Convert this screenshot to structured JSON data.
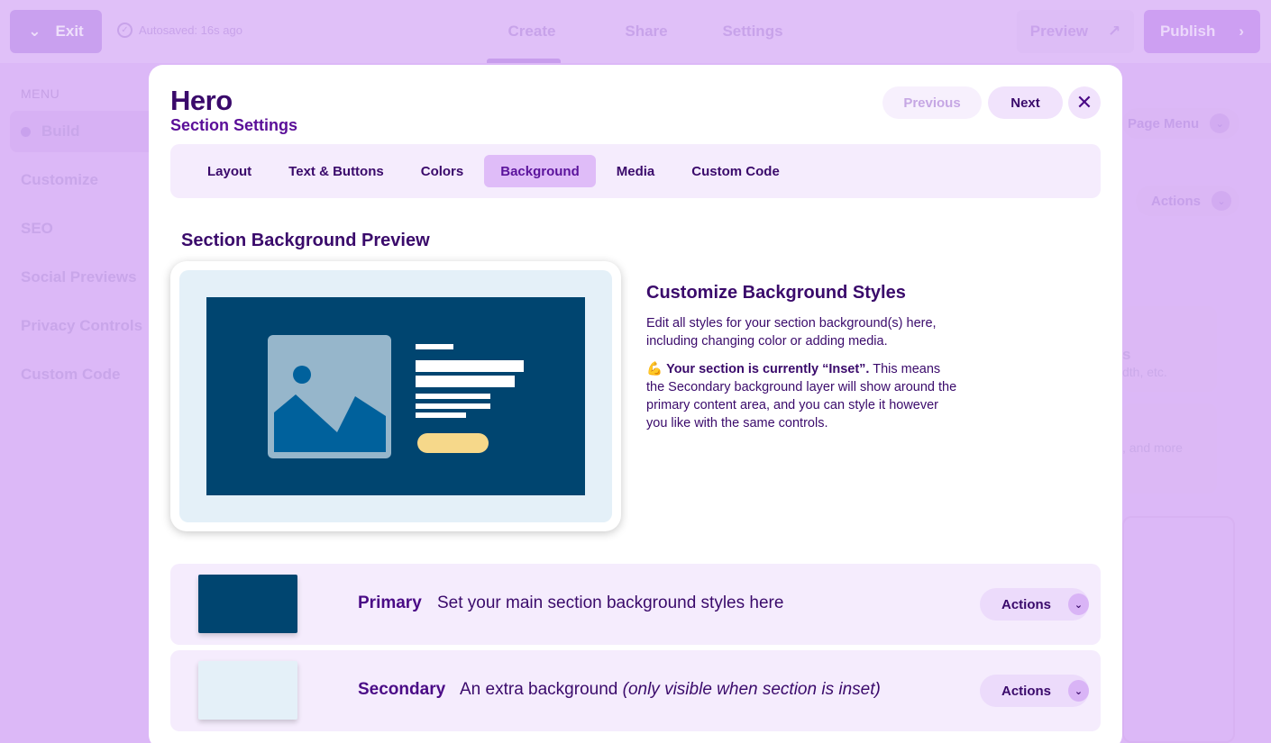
{
  "topbar": {
    "exit_label": "Exit",
    "autosave_text": "Autosaved: 16s ago",
    "tabs": [
      "Create",
      "Share",
      "Settings"
    ],
    "preview_label": "Preview",
    "publish_label": "Publish"
  },
  "sidebar": {
    "heading": "MENU",
    "items": [
      "Build",
      "Customize",
      "SEO",
      "Social Previews",
      "Privacy Controls",
      "Custom Code"
    ]
  },
  "right_bg": {
    "page_menu_label": "Page Menu",
    "actions_label": "Actions",
    "text1": "s",
    "text2": "dth, etc.",
    "text3": ", and more"
  },
  "modal": {
    "title": "Hero",
    "subtitle": "Section Settings",
    "previous_label": "Previous",
    "next_label": "Next",
    "close_symbol": "✕",
    "tabs": [
      "Layout",
      "Text & Buttons",
      "Colors",
      "Background",
      "Media",
      "Custom Code"
    ],
    "active_tab": "Background",
    "preview_heading": "Section Background Preview",
    "info_title": "Customize Background Styles",
    "info_p1": "Edit all styles for your section background(s) here, including changing color or adding media.",
    "info_p2_emoji": "💪",
    "info_p2_bold": "Your section is currently “Inset”.",
    "info_p2_rest": "This means the Secondary background layer will show around the primary content area, and you can style it however you like with the same controls.",
    "layers": [
      {
        "name": "Primary",
        "desc": "Set your main section background styles here",
        "desc_italic": "",
        "swatch_color": "#004570",
        "actions_label": "Actions"
      },
      {
        "name": "Secondary",
        "desc": "An extra background ",
        "desc_italic": "(only visible when section is inset)",
        "swatch_color": "#e4f0f8",
        "actions_label": "Actions"
      }
    ]
  },
  "colors": {
    "accent": "#3a0a6b",
    "primary_bg": "#004570",
    "secondary_bg": "#e4f0f8",
    "button_yellow": "#f6d88a",
    "image_placeholder": "#96b6cb",
    "image_mountain": "#00619c"
  }
}
